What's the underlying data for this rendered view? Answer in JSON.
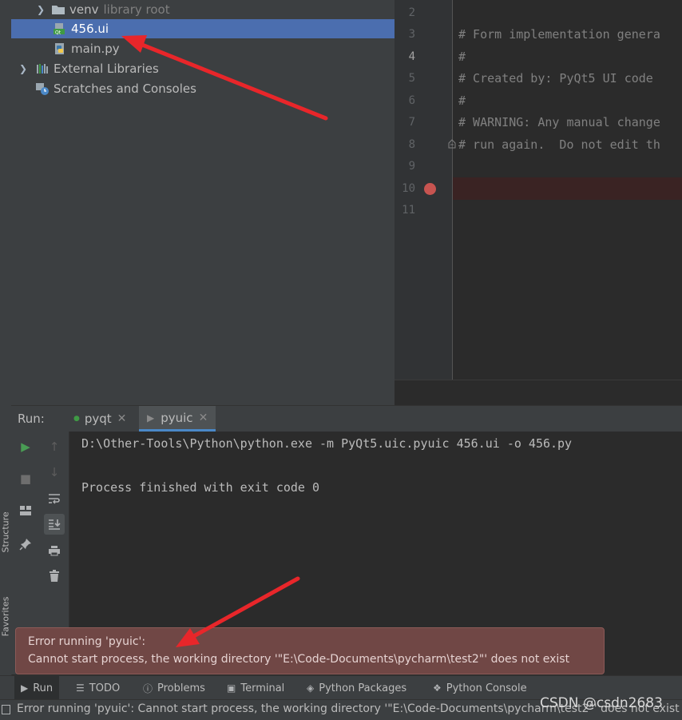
{
  "side_strip": {
    "structure": "Structure",
    "favorites": "Favorites"
  },
  "project_tree": {
    "items": [
      {
        "label": "venv",
        "suffix": "library root",
        "icon": "folder-icon"
      },
      {
        "label": "456.ui",
        "icon": "qt-file-icon",
        "selected": true
      },
      {
        "label": "main.py",
        "icon": "python-file-icon"
      },
      {
        "label": "External Libraries",
        "icon": "library-icon"
      },
      {
        "label": "Scratches and Consoles",
        "icon": "scratches-icon"
      }
    ]
  },
  "editor": {
    "line_numbers": [
      "2",
      "3",
      "4",
      "5",
      "6",
      "7",
      "8",
      "9",
      "10",
      "11"
    ],
    "current_line": "4",
    "breakpoint_line": "10",
    "lines": [
      "",
      "# Form implementation genera",
      "#",
      "# Created by: PyQt5 UI code",
      "#",
      "# WARNING: Any manual change",
      "# run again.  Do not edit th",
      "",
      "",
      ""
    ]
  },
  "run_panel": {
    "title": "Run:",
    "tabs": [
      {
        "label": "pyqt",
        "active": false
      },
      {
        "label": "pyuic",
        "active": true
      }
    ],
    "console": [
      "D:\\Other-Tools\\Python\\python.exe -m PyQt5.uic.pyuic 456.ui -o 456.py",
      "Process finished with exit code 0"
    ]
  },
  "error_balloon": {
    "title": "Error running 'pyuic':",
    "message": "Cannot start process, the working directory '\"E:\\Code-Documents\\pycharm\\test2\"' does not exist"
  },
  "bottom_toolbar": {
    "tabs": [
      {
        "label": "Run",
        "icon": "run-icon"
      },
      {
        "label": "TODO",
        "icon": "todo-icon"
      },
      {
        "label": "Problems",
        "icon": "problems-icon"
      },
      {
        "label": "Terminal",
        "icon": "terminal-icon"
      },
      {
        "label": "Python Packages",
        "icon": "packages-icon"
      },
      {
        "label": "Python Console",
        "icon": "python-console-icon"
      }
    ]
  },
  "status_bar": {
    "text": "Error running 'pyuic': Cannot start process, the working directory '\"E:\\Code-Documents\\pycharm\\test2\"' does not exist"
  },
  "watermark": "CSDN @csdn2683",
  "colors": {
    "annotation_arrow": "#e8262a",
    "selection": "#4b6eaf",
    "error_balloon": "#704745",
    "breakpoint": "#c75450"
  }
}
